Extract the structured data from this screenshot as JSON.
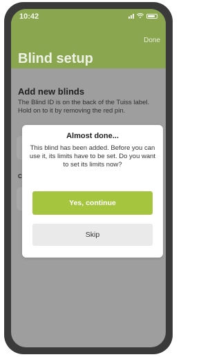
{
  "status_bar": {
    "time": "10:42"
  },
  "header": {
    "done_label": "Done",
    "title": "Blind setup"
  },
  "content": {
    "section_title": "Add new blinds",
    "section_desc": "The Blind ID is on the back of the Tuiss label. Hold on to it by removing the red pin.",
    "partial_label": "C"
  },
  "modal": {
    "title": "Almost done...",
    "body": "This blind has been added. Before you can use it, its limits have to be set. Do you want to set its limits now?",
    "primary_label": "Yes, continue",
    "secondary_label": "Skip"
  },
  "colors": {
    "header_green": "#8aa74f",
    "primary_button": "#a5c53f"
  }
}
